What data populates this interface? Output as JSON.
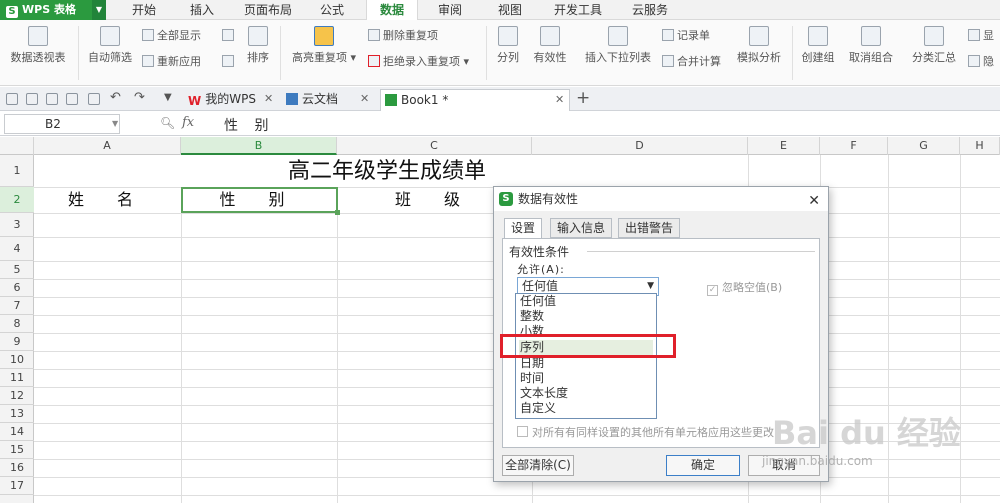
{
  "app": {
    "name": "WPS 表格",
    "logo_letter": "S"
  },
  "menu": [
    "开始",
    "插入",
    "页面布局",
    "公式",
    "数据",
    "审阅",
    "视图",
    "开发工具",
    "云服务"
  ],
  "menu_active": "数据",
  "ribbon": {
    "pivot": "数据透视表",
    "autofilter": "自动筛选",
    "show_all": "全部显示",
    "reapply": "重新应用",
    "sort": "排序",
    "highlight_dup": "高亮重复项",
    "remove_dup": "删除重复项",
    "reject_dup": "拒绝录入重复项",
    "split": "分列",
    "validity": "有效性",
    "insert_dropdown": "插入下拉列表",
    "records": "记录单",
    "consolidate": "合并计算",
    "simulate": "模拟分析",
    "group": "创建组",
    "ungroup": "取消组合",
    "subtotal": "分类汇总",
    "show_detail": "显",
    "hide_detail": "隐"
  },
  "doc_tabs": [
    "我的WPS",
    "云文档",
    "Book1 *"
  ],
  "formula_bar": {
    "name_box": "B2",
    "fx": "fx",
    "content": "性 别"
  },
  "columns": [
    "A",
    "B",
    "C",
    "D",
    "E",
    "F",
    "G",
    "H"
  ],
  "rows": [
    "1",
    "2",
    "3",
    "4",
    "5",
    "6",
    "7",
    "8",
    "9",
    "10",
    "11",
    "12",
    "13",
    "14",
    "15",
    "16",
    "17"
  ],
  "sheet": {
    "title": "高二年级学生成绩单",
    "a2": "姓 名",
    "b2": "性 别",
    "c2": "班 级"
  },
  "dialog": {
    "title": "数据有效性",
    "tabs": [
      "设置",
      "输入信息",
      "出错警告"
    ],
    "condition_label": "有效性条件",
    "allow_label": "允许(A):",
    "allow_value": "任何值",
    "ignore_blank": "忽略空值(B)",
    "apply_all": "对所有有同样设置的其他所有单元格应用这些更改",
    "clear_all": "全部清除(C)",
    "ok": "确定",
    "cancel": "取消",
    "options": [
      "任何值",
      "整数",
      "小数",
      "序列",
      "日期",
      "时间",
      "文本长度",
      "自定义"
    ],
    "highlighted_option": "序列"
  },
  "watermark": {
    "brand": "Bai du 经验",
    "url": "jingyan.baidu.com"
  },
  "colors": {
    "accent": "#2b9a3f",
    "highlight_border": "#e0202a",
    "selection": "#5aa35a"
  }
}
